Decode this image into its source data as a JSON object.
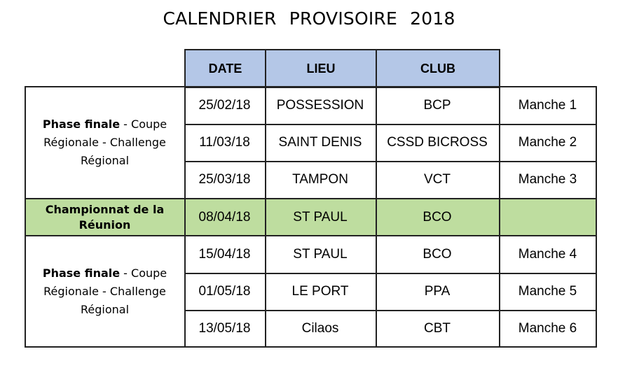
{
  "title": "CALENDRIER   PROVISOIRE   2018",
  "header": {
    "date": "DATE",
    "lieu": "LIEU",
    "club": "CLUB"
  },
  "sections": [
    {
      "bold": "Phase finale",
      "rest": " - Coupe Régionale - Challenge Régional"
    },
    {
      "bold": "Championnat de la Réunion",
      "rest": ""
    },
    {
      "bold": "Phase finale",
      "rest": " - Coupe Régionale - Challenge Régional"
    }
  ],
  "rows": [
    {
      "date": "25/02/18",
      "lieu": "POSSESSION",
      "club": "BCP",
      "manche": "Manche 1"
    },
    {
      "date": "11/03/18",
      "lieu": "SAINT DENIS",
      "club": "CSSD BICROSS",
      "manche": "Manche 2"
    },
    {
      "date": "25/03/18",
      "lieu": "TAMPON",
      "club": "VCT",
      "manche": "Manche 3"
    },
    {
      "date": "08/04/18",
      "lieu": "ST PAUL",
      "club": "BCO",
      "manche": ""
    },
    {
      "date": "15/04/18",
      "lieu": "ST PAUL",
      "club": "BCO",
      "manche": "Manche 4"
    },
    {
      "date": "01/05/18",
      "lieu": "LE PORT",
      "club": "PPA",
      "manche": "Manche 5"
    },
    {
      "date": "13/05/18",
      "lieu": "Cilaos",
      "club": "CBT",
      "manche": "Manche 6"
    }
  ],
  "colors": {
    "header_bg": "#b4c7e7",
    "championship_bg": "#bedd9f"
  }
}
